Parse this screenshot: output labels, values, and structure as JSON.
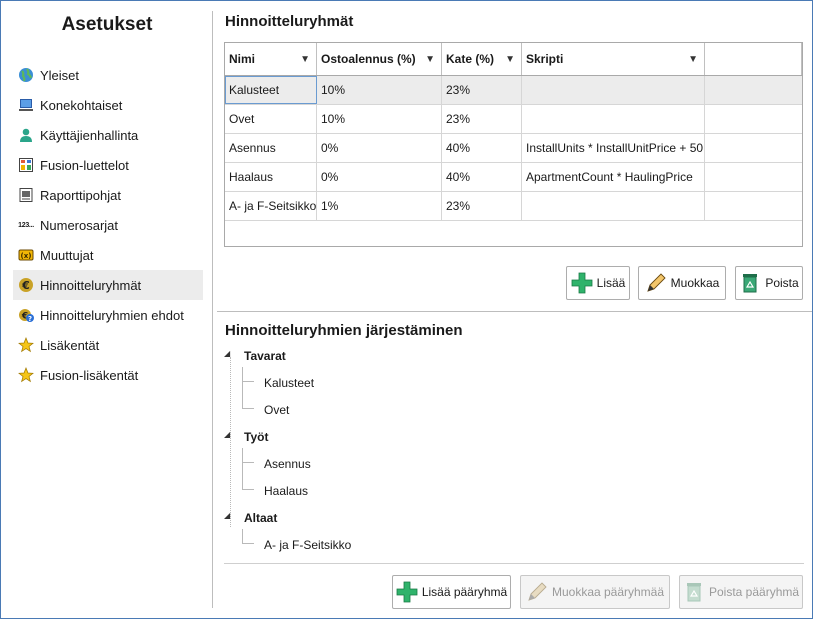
{
  "sidebar": {
    "title": "Asetukset",
    "items": [
      {
        "label": "Yleiset",
        "icon": "globe-icon"
      },
      {
        "label": "Konekohtaiset",
        "icon": "computer-icon"
      },
      {
        "label": "Käyttäjienhallinta",
        "icon": "user-icon"
      },
      {
        "label": "Fusion-luettelot",
        "icon": "catalog-icon"
      },
      {
        "label": "Raporttipohjat",
        "icon": "report-icon"
      },
      {
        "label": "Numerosarjat",
        "icon": "number-series-icon",
        "icon_text": "123..."
      },
      {
        "label": "Muuttujat",
        "icon": "variable-icon"
      },
      {
        "label": "Hinnoitteluryhmät",
        "icon": "euro-icon",
        "active": true
      },
      {
        "label": "Hinnoitteluryhmien ehdot",
        "icon": "euro-question-icon"
      },
      {
        "label": "Lisäkentät",
        "icon": "star-icon"
      },
      {
        "label": "Fusion-lisäkentät",
        "icon": "star-icon"
      }
    ]
  },
  "pricing_groups": {
    "title": "Hinnoitteluryhmät",
    "columns": [
      "Nimi",
      "Ostoalennus (%)",
      "Kate (%)",
      "Skripti",
      ""
    ],
    "rows": [
      [
        "Kalusteet",
        "10%",
        "23%",
        "",
        ""
      ],
      [
        "Ovet",
        "10%",
        "23%",
        "",
        ""
      ],
      [
        "Asennus",
        "0%",
        "40%",
        "InstallUnits * InstallUnitPrice + 50",
        ""
      ],
      [
        "Haalaus",
        "0%",
        "40%",
        "ApartmentCount * HaulingPrice",
        ""
      ],
      [
        "A- ja F-Seitsikko",
        "1%",
        "23%",
        "",
        ""
      ]
    ],
    "buttons": {
      "add": "Lisää",
      "edit": "Muokkaa",
      "delete": "Poista"
    }
  },
  "ordering": {
    "title": "Hinnoitteluryhmien järjestäminen",
    "groups": [
      {
        "name": "Tavarat",
        "children": [
          "Kalusteet",
          "Ovet"
        ]
      },
      {
        "name": "Työt",
        "children": [
          "Asennus",
          "Haalaus"
        ]
      },
      {
        "name": "Altaat",
        "children": [
          "A- ja F-Seitsikko"
        ]
      }
    ],
    "buttons": {
      "add": "Lisää pääryhmä",
      "edit": "Muokkaa pääryhmää",
      "delete": "Poista pääryhmä"
    }
  },
  "colors": {
    "accent": "#4a7ab5",
    "selected_row": "#ececec",
    "add_green": "#2fb36b"
  }
}
